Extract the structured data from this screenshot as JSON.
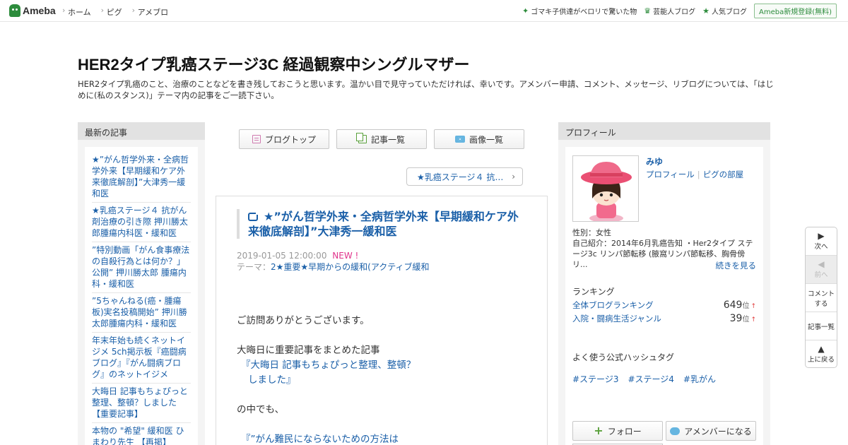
{
  "topbar": {
    "logo": "Ameba",
    "nav": [
      "ホーム",
      "ピグ",
      "アメブロ"
    ],
    "links": [
      {
        "icon": "sparkle-icon",
        "label": "ゴマキ子供達がベロリで驚いた物"
      },
      {
        "icon": "crown-icon",
        "label": "芸能人ブログ"
      },
      {
        "icon": "star-icon",
        "label": "人気ブログ"
      }
    ],
    "register": "Ameba新規登録(無料)"
  },
  "header": {
    "title": "HER2タイプ乳癌ステージ3C 経過観察中シングルマザー",
    "description": "HER2タイプ乳癌のこと、治療のことなどを書き残しておこうと思います。温かい目で見守っていただければ、幸いです。アメンバー申請、コメント、メッセージ、リブログについては、「はじめに(私のスタンス)」テーマ内の記事をご一読下さい。"
  },
  "left": {
    "heading": "最新の記事",
    "recent": [
      "★”がん哲学外来・全病哲学外来【早期緩和ケア外来徹底解剖】”大津秀一緩和医",
      "★乳癌ステージ４ 抗がん剤治療の引き際 押川勝太郎腫瘍内科医・緩和医",
      "”特別動画「がん食事療法の自殺行為とは何か？」公開” 押川勝太郎 腫瘍内科・緩和医",
      "”5ちゃんねる(癌・腫瘍板)実名投稿開始” 押川勝太郎腫瘍内科・緩和医",
      "年末年始も続くネットイジメ 5ch掲示板『癌闘病ブログ』『がん闘病ブログ』のネットイジメ",
      "大晦日 記事もちょぴっと整理、整頓？しました【重要記事】",
      "本物の \"希望\" 緩和医 ひまわり先生 【再掲】"
    ]
  },
  "center": {
    "nav_buttons": [
      "ブログトップ",
      "記事一覧",
      "画像一覧"
    ],
    "prev_article": "★乳癌ステージ４ 抗…",
    "article": {
      "title": "★”がん哲学外来・全病哲学外来【早期緩和ケア外来徹底解剖】”大津秀一緩和医",
      "date": "2019-01-05 12:00:00",
      "new_badge": "NEW !",
      "theme_label": "テーマ：",
      "theme": "2★重要★早期からの緩和(アクティブ緩和",
      "body": {
        "p1": "ご訪問ありがとうございます。",
        "p2": "大晦日に重要記事をまとめた記事",
        "quote1a": "『大晦日  記事もちょぴっと整理、整頓？",
        "quote1b": "しました』",
        "p3": "の中でも、",
        "quote2": "『”がん難民にならないための方法は"
      }
    }
  },
  "right": {
    "heading": "プロフィール",
    "name": "みゆ",
    "profile_link": "プロフィール",
    "pigg_link": "ピグの部屋",
    "gender": "性別：女性",
    "intro": "自己紹介：2014年6月乳癌告知 ・Her2タイプ ステージ3c リンパ節転移 (腋窩リンパ節転移、胸骨傍リ...",
    "more": "続きを見る",
    "ranking_heading": "ランキング",
    "rankings": [
      {
        "label": "全体ブログランキング",
        "rank": "649",
        "unit": "位",
        "trend": "↑"
      },
      {
        "label": "入院・闘病生活ジャンル",
        "rank": "39",
        "unit": "位",
        "trend": "↑"
      }
    ],
    "hashtag_heading": "よく使う公式ハッシュタグ",
    "hashtags": [
      "#ステージ3",
      "#ステージ4",
      "#乳がん"
    ],
    "follow": "フォロー",
    "amember": "アメンバーになる"
  },
  "side_nav": {
    "next": "次へ",
    "prev": "前へ",
    "comment_line1": "コメント",
    "comment_line2": "する",
    "list": "記事一覧",
    "top": "上に戻る"
  },
  "colors": {
    "brand": "#2d8c3c",
    "link": "#1a5fa8",
    "new_badge": "#e0338b",
    "column_bg": "#f4f4f4"
  }
}
